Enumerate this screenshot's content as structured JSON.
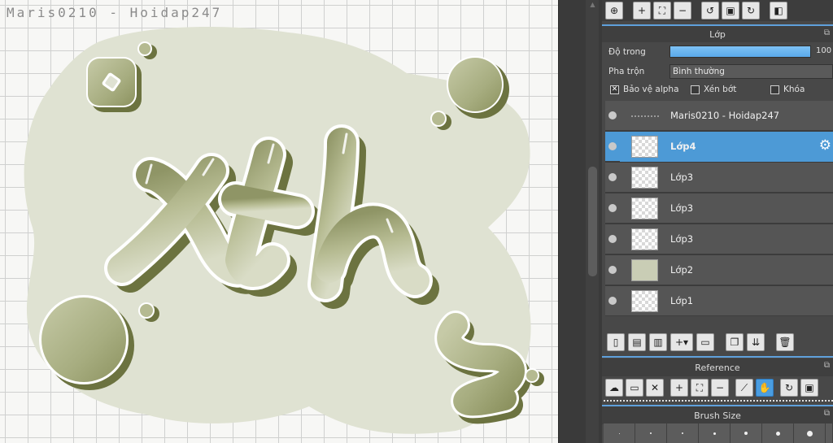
{
  "canvas": {
    "watermark": "Maris0210 - Hoidap247"
  },
  "top_toolbar": {
    "buttons": [
      "zoom-reset-icon",
      "zoom-in-icon",
      "fit-icon",
      "zoom-out-icon",
      "rotate-left-icon",
      "fullscreen-icon",
      "rotate-right-icon",
      "flip-icon"
    ]
  },
  "layers_panel": {
    "title": "Lớp",
    "opacity_label": "Độ trong",
    "opacity_value": "100",
    "opacity_fraction": 1.0,
    "blend_label": "Pha trộn",
    "blend_value": "Bình thường",
    "protect_alpha_label": "Bảo vệ alpha",
    "protect_alpha_checked": true,
    "clip_label": "Xén bớt",
    "clip_checked": false,
    "lock_label": "Khóa",
    "lock_checked": false,
    "layers": [
      {
        "name": "Maris0210 - Hoidap247",
        "selected": false,
        "kind": "text"
      },
      {
        "name": "Lớp4",
        "selected": true,
        "kind": "raster"
      },
      {
        "name": "Lớp3",
        "selected": false,
        "kind": "raster"
      },
      {
        "name": "Lớp3",
        "selected": false,
        "kind": "raster"
      },
      {
        "name": "Lớp3",
        "selected": false,
        "kind": "raster"
      },
      {
        "name": "Lớp2",
        "selected": false,
        "kind": "raster"
      },
      {
        "name": "Lớp1",
        "selected": false,
        "kind": "raster"
      }
    ]
  },
  "reference_panel": {
    "title": "Reference"
  },
  "brush_size_panel": {
    "title": "Brush Size"
  },
  "colors": {
    "accent": "#4d9ad6",
    "panel_bg": "#484848",
    "art_light": "#dfe2d2",
    "art_mid": "#a9ae83",
    "art_dark": "#6c7340"
  }
}
